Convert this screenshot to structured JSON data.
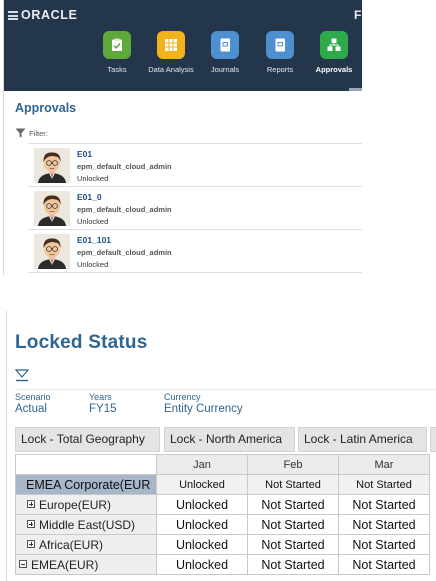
{
  "topbar": {
    "logo": "ORACLE",
    "corner_text": "F",
    "nav": [
      {
        "label": "Tasks",
        "icon": "tasks-icon",
        "color": "#5fa83a"
      },
      {
        "label": "Data Analysis",
        "icon": "data-analysis-icon",
        "color": "#f2b31a"
      },
      {
        "label": "Journals",
        "icon": "journals-icon",
        "color": "#4d8fcf"
      },
      {
        "label": "Reports",
        "icon": "reports-icon",
        "color": "#4d8fcf"
      },
      {
        "label": "Approvals",
        "icon": "approvals-icon",
        "color": "#2eaa4a",
        "active": true
      }
    ]
  },
  "approvals": {
    "title": "Approvals",
    "filter_label": "Filter:",
    "items": [
      {
        "name": "E01",
        "user": "epm_default_cloud_admin",
        "status": "Unlocked"
      },
      {
        "name": "E01_0",
        "user": "epm_default_cloud_admin",
        "status": "Unlocked"
      },
      {
        "name": "E01_101",
        "user": "epm_default_cloud_admin",
        "status": "Unlocked"
      }
    ]
  },
  "locked_status": {
    "title": "Locked Status",
    "pov": [
      {
        "header": "Scenario",
        "value": "Actual"
      },
      {
        "header": "Years",
        "value": "FY15"
      },
      {
        "header": "Currency",
        "value": "Entity Currency"
      }
    ],
    "lock_buttons": [
      "Lock - Total Geography",
      "Lock - North America",
      "Lock - Latin America"
    ],
    "grid": {
      "columns": [
        "Jan",
        "Feb",
        "Mar"
      ],
      "rows": [
        {
          "label": "EMEA Corporate(EUR",
          "values": [
            "Unlocked",
            "Not Started",
            "Not Started"
          ]
        },
        {
          "label": "Europe(EUR)",
          "values": [
            "Unlocked",
            "Not Started",
            "Not Started"
          ]
        },
        {
          "label": "Middle East(USD)",
          "values": [
            "Unlocked",
            "Not Started",
            "Not Started"
          ]
        },
        {
          "label": "Africa(EUR)",
          "values": [
            "Unlocked",
            "Not Started",
            "Not Started"
          ]
        },
        {
          "label": "EMEA(EUR)",
          "values": [
            "Unlocked",
            "Not Started",
            "Not Started"
          ]
        }
      ]
    }
  },
  "colors": {
    "navbar": "#24364b",
    "title_blue": "#2f6591",
    "link_blue": "#1f4f86",
    "corporate_row": "#a7b6c9"
  }
}
